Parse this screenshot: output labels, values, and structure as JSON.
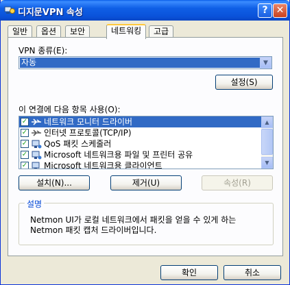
{
  "window": {
    "title": "디지문VPN 속성",
    "help_label": "?",
    "close_label": "✕"
  },
  "tabs": [
    {
      "label": "일반"
    },
    {
      "label": "옵션"
    },
    {
      "label": "보안"
    },
    {
      "label": "네트워킹",
      "active": true
    },
    {
      "label": "고급"
    }
  ],
  "vpn_type": {
    "label": "VPN 종류(E):",
    "selected": "자동",
    "settings_button": "설정(S)"
  },
  "components": {
    "label": "이 연결에 다음 항목 사용(O):",
    "items": [
      {
        "label": "네트워크 모니터 드라이버",
        "checked": true,
        "selected": true,
        "icon": "network-protocol-icon"
      },
      {
        "label": "인터넷 프로토콜(TCP/IP)",
        "checked": true,
        "selected": false,
        "icon": "network-protocol-icon"
      },
      {
        "label": "QoS 패킷 스케줄러",
        "checked": true,
        "selected": false,
        "icon": "network-service-icon"
      },
      {
        "label": "Microsoft 네트워크용 파일 및 프린터 공유",
        "checked": true,
        "selected": false,
        "icon": "network-service-icon"
      },
      {
        "label": "Microsoft 네트워크용 클라이언트",
        "checked": true,
        "selected": false,
        "icon": "network-client-icon"
      }
    ]
  },
  "buttons": {
    "install": "설치(N)...",
    "remove": "제거(U)",
    "properties": "속성(R)",
    "ok": "확인",
    "cancel": "취소"
  },
  "description": {
    "title": "설명",
    "text": "Netmon UI가 로컬 네트워크에서 패킷을 얻을 수 있게 하는 Netmon 패킷 캡처 드라이버입니다."
  },
  "colors": {
    "titlebar": "#0a52da",
    "selection": "#316ac5",
    "tab_highlight": "#ffc83c"
  }
}
